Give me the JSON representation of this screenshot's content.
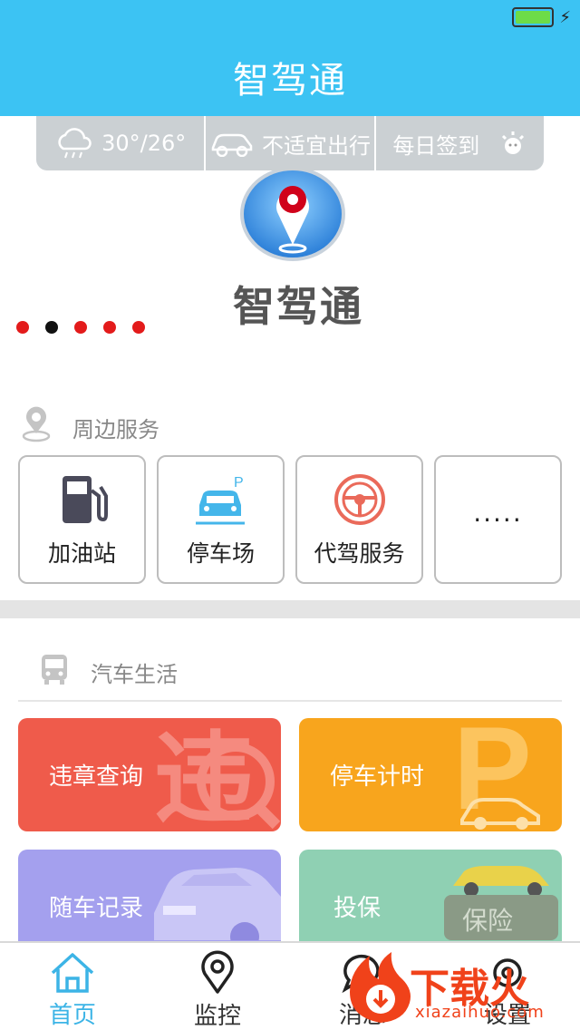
{
  "header": {
    "title": "智驾通"
  },
  "infobar": {
    "weather": "30°/26°",
    "travel": "不适宜出行",
    "checkin": "每日签到"
  },
  "banner": {
    "text": "智驾通"
  },
  "nearby": {
    "title": "周边服务",
    "items": [
      {
        "label": "加油站",
        "icon": "gas-station-icon"
      },
      {
        "label": "停车场",
        "icon": "parking-car-icon"
      },
      {
        "label": "代驾服务",
        "icon": "steering-wheel-icon"
      },
      {
        "label": "·····",
        "icon": "more-icon"
      }
    ]
  },
  "car_life": {
    "title": "汽车生活",
    "cards": [
      {
        "label": "违章查询",
        "color": "#ef5b4b"
      },
      {
        "label": "停车计时",
        "color": "#f8a51d"
      },
      {
        "label": "随车记录",
        "color": "#a4a0ee"
      },
      {
        "label": "投保",
        "color": "#8fd0b3"
      }
    ]
  },
  "tabbar": {
    "items": [
      {
        "label": "首页",
        "icon": "home-icon"
      },
      {
        "label": "监控",
        "icon": "location-pin-icon"
      },
      {
        "label": "消息",
        "icon": "chat-icon"
      },
      {
        "label": "设置",
        "icon": "settings-icon"
      }
    ]
  },
  "watermark": {
    "text": "下载火",
    "url": "xiazaihuo.com"
  },
  "colors": {
    "primary": "#3cc3f3",
    "tab_active": "#3cb4e6",
    "dot": "#e31b1b"
  }
}
